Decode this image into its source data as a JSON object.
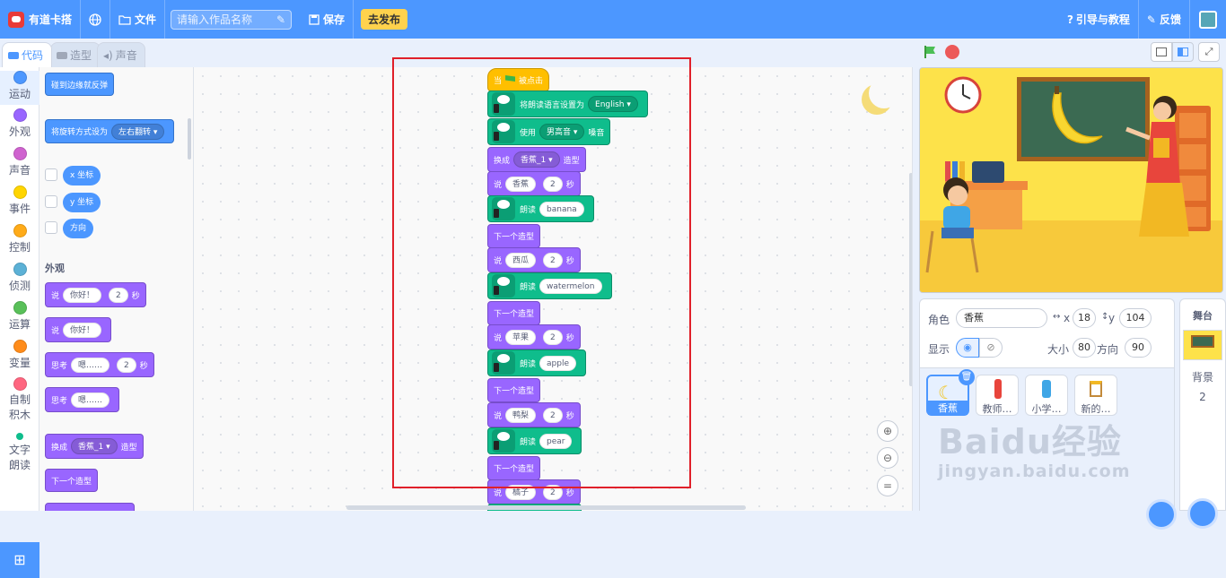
{
  "menubar": {
    "app_name": "有道卡搭",
    "file_label": "文件",
    "title_placeholder": "请输入作品名称",
    "save_label": "保存",
    "publish_label": "去发布",
    "guide_label": "引导与教程",
    "feedback_label": "反馈"
  },
  "tabs": {
    "code": "代码",
    "costume": "造型",
    "sound": "声音"
  },
  "categories": [
    {
      "label": "运动",
      "color": "#4c97ff"
    },
    {
      "label": "外观",
      "color": "#9966ff"
    },
    {
      "label": "声音",
      "color": "#cf63cf"
    },
    {
      "label": "事件",
      "color": "#ffd500"
    },
    {
      "label": "控制",
      "color": "#ffab19"
    },
    {
      "label": "侦测",
      "color": "#5cb1d6"
    },
    {
      "label": "运算",
      "color": "#59c059"
    },
    {
      "label": "变量",
      "color": "#ff8c1a"
    },
    {
      "label": "自制积木",
      "color": "#ff6680"
    },
    {
      "label": "文字朗读",
      "color": "#0fbd8c"
    }
  ],
  "palette": {
    "bounce": "碰到边缘就反弹",
    "rotation": "将旋转方式设为",
    "rotation_opt": "左右翻转",
    "x_rep": "x 坐标",
    "y_rep": "y 坐标",
    "dir_rep": "方向",
    "looks_head": "外观",
    "say": "说",
    "think": "思考",
    "hello": "你好！",
    "hmm": "嗯……",
    "two": "2",
    "sec": "秒",
    "switch": "换成",
    "costume_opt": "香蕉_1",
    "costume_word": "造型",
    "next": "下一个造型"
  },
  "script": {
    "when": "当",
    "clicked": "被点击",
    "set_lang_pre": "将朗读语言设置为",
    "lang": "English",
    "use": "使用",
    "voice": "男高音",
    "voice_post": "嗓音",
    "switch": "换成",
    "costume": "香蕉_1",
    "costume_post": "造型",
    "say": "说",
    "sec": "秒",
    "secs": "2",
    "read": "朗读",
    "next": "下一个造型",
    "items": [
      {
        "cn": "香蕉",
        "en": "banana"
      },
      {
        "cn": "西瓜",
        "en": "watermelon"
      },
      {
        "cn": "苹果",
        "en": "apple"
      },
      {
        "cn": "鸭梨",
        "en": "pear"
      },
      {
        "cn": "橘子",
        "en": ""
      }
    ]
  },
  "sprite_info": {
    "sprite_label": "角色",
    "sprite_name": "香蕉",
    "x_label": "x",
    "x": "18",
    "y_label": "y",
    "y": "104",
    "show_label": "显示",
    "size_label": "大小",
    "size": "80",
    "dir_label": "方向",
    "direction": "90"
  },
  "sprites": [
    "香蕉",
    "教师…",
    "小学…",
    "新的…"
  ],
  "stage_panel": {
    "title": "舞台",
    "backdrops_label": "背景",
    "backdrops_count": "2"
  },
  "watermark": {
    "line1": "Baidu经验",
    "line2": "jingyan.baidu.com"
  }
}
